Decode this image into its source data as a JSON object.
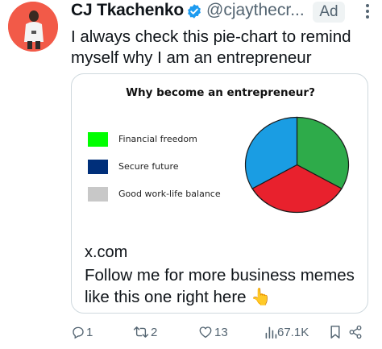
{
  "post": {
    "author_name": "CJ Tkachenko",
    "handle": "@cjaythecr...",
    "ad_label": "Ad",
    "text_lines": [
      "I always check this pie-chart to remind",
      "myself why I am an entrepreneur"
    ]
  },
  "card": {
    "domain": "x.com",
    "description": "Follow me for more business memes like this one right here 👆"
  },
  "chart_data": {
    "type": "pie",
    "title": "Why become an entrepreneur?",
    "labels": [
      "Financial freedom",
      "Secure future",
      "Good work-life balance"
    ],
    "values": [
      33.3,
      33.3,
      33.3
    ],
    "colors": [
      "#00ff00",
      "#002f7a",
      "#c8c8c8"
    ],
    "legend": "left"
  },
  "pie_visual": {
    "slices": [
      {
        "value": 33.3,
        "color": "#2eab4a"
      },
      {
        "value": 33.3,
        "color": "#e8212d"
      },
      {
        "value": 33.3,
        "color": "#1a9de3"
      }
    ]
  },
  "actions": {
    "replies": "1",
    "reposts": "2",
    "likes": "13",
    "views": "67.1K"
  },
  "colors": {
    "avatar_bg": "#f25a48",
    "verified": "#1d9bf0",
    "muted": "#536471",
    "border": "#cfd9de"
  }
}
